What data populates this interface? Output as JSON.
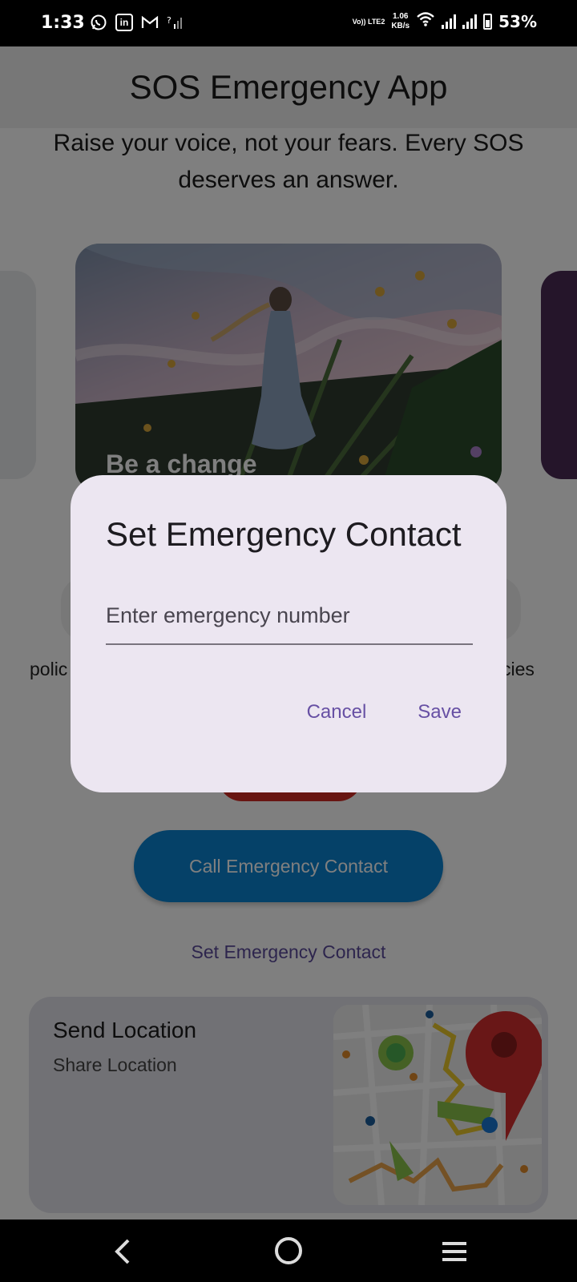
{
  "status_bar": {
    "time": "1:33",
    "left_icons": [
      "whatsapp-icon",
      "linkedin-icon",
      "gmail-icon",
      "signal-unknown-icon"
    ],
    "volte": "Vo)) LTE2",
    "net_speed_value": "1.06",
    "net_speed_unit": "KB/s",
    "battery": "53%"
  },
  "app_bar": {
    "title": "SOS Emergency App"
  },
  "tagline": "Raise your voice, not your fears. Every SOS deserves an answer.",
  "carousel": {
    "caption": "Be a change"
  },
  "categories": {
    "left_label_partial": "polic",
    "right_label_partial": "cies"
  },
  "actions": {
    "call_label": "Call Emergency Contact",
    "set_contact_label": "Set Emergency Contact"
  },
  "location_card": {
    "title": "Send Location",
    "subtitle": "Share Location"
  },
  "dialog": {
    "title": "Set Emergency Contact",
    "input_placeholder": "Enter emergency number",
    "input_value": "",
    "cancel_label": "Cancel",
    "save_label": "Save"
  },
  "colors": {
    "dialog_bg": "#ece6f1",
    "dialog_button": "#6750a4",
    "call_button": "#0a82d0",
    "sos_button": "#d02a24",
    "scrim": "rgba(0,0,0,0.5)"
  },
  "nav_bar": {
    "icons": [
      "back-icon",
      "home-icon",
      "recents-icon"
    ]
  }
}
